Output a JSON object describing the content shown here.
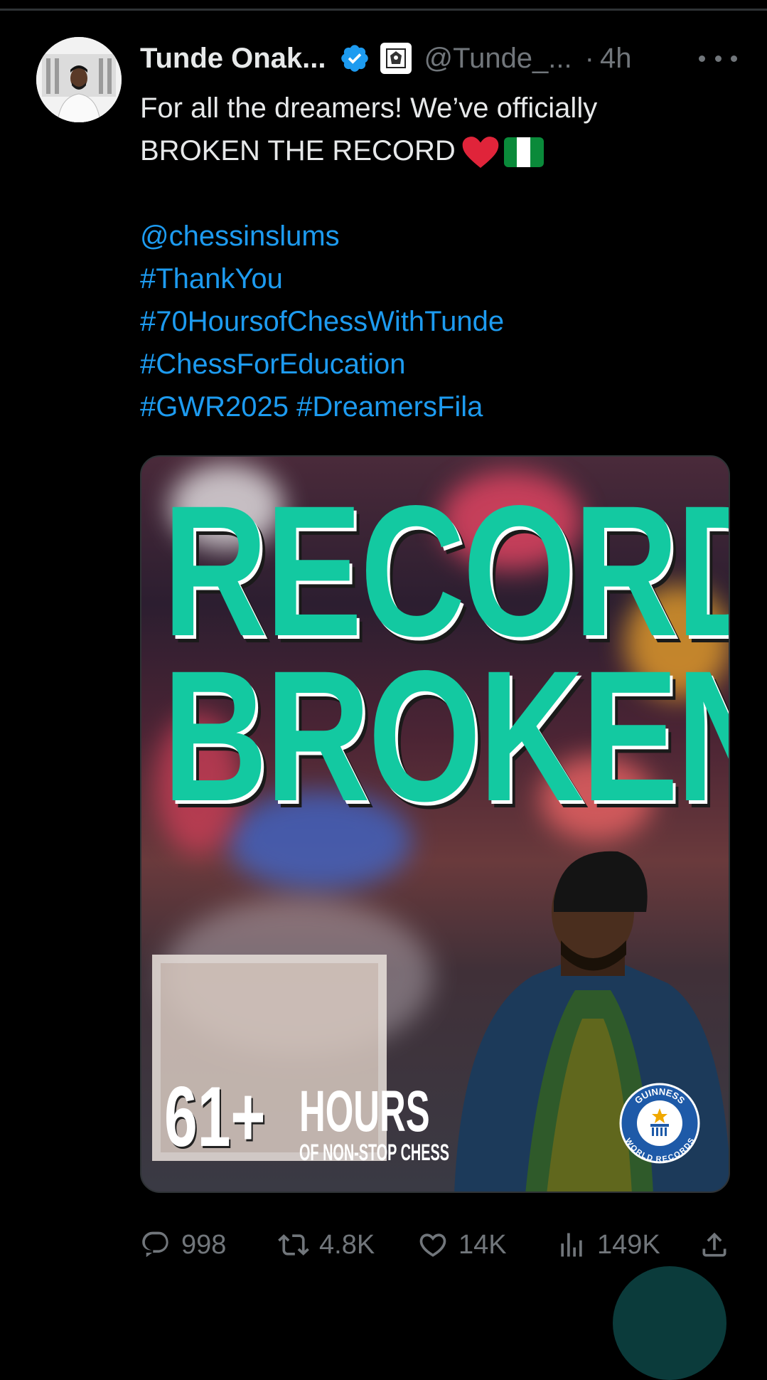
{
  "tweet": {
    "author": {
      "display_name": "Tunde Onak...",
      "handle": "@Tunde_...",
      "time": "4h",
      "separator": "·"
    },
    "text": {
      "line1": "For all the dreamers! We’ve officially",
      "line2": "BROKEN THE RECORD",
      "mention": "@chessinslums",
      "tag1": "#ThankYou",
      "tag2": "#70HoursofChessWithTunde",
      "tag3": "#ChessForEducation",
      "tag4": "#GWR2025",
      "tag5": "#DreamersFila"
    },
    "media": {
      "headline_line1": "RECORD",
      "headline_line2": "BROKEN",
      "hours_number": "61+",
      "hours_word": "HOURS",
      "hours_subtitle": "OF NON-STOP CHESS",
      "logo_text_top": "GUINNESS",
      "logo_text_bottom": "WORLD RECORDS"
    },
    "metrics": {
      "replies": "998",
      "reposts": "4.8K",
      "likes": "14K",
      "views": "149K"
    }
  },
  "colors": {
    "background": "#000000",
    "link": "#1d9bf0",
    "muted": "#71767b",
    "headline_teal": "#13c9a1",
    "verified": "#1d9bf0"
  },
  "icons": [
    "verified-badge-icon",
    "org-badge-icon",
    "more-icon",
    "heart-emoji",
    "nigeria-flag-emoji",
    "reply-icon",
    "repost-icon",
    "like-icon",
    "views-icon",
    "share-icon",
    "guinness-logo"
  ]
}
